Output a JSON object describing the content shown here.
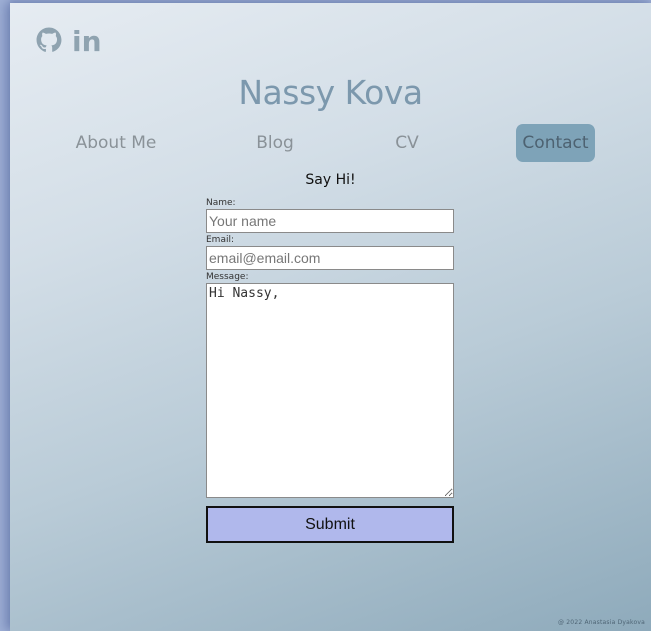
{
  "social": {
    "github_icon": "github-icon",
    "linkedin_icon": "linkedin-icon",
    "linkedin_text": "in"
  },
  "header": {
    "brand": "Nassy Kova"
  },
  "nav": {
    "items": [
      {
        "label": "About Me",
        "active": false
      },
      {
        "label": "Blog",
        "active": false
      },
      {
        "label": "CV",
        "active": false
      },
      {
        "label": "Contact",
        "active": true
      }
    ]
  },
  "contact": {
    "heading": "Say Hi!",
    "name_label": "Name:",
    "name_placeholder": "Your name",
    "email_label": "Email:",
    "email_placeholder": "email@email.com",
    "message_label": "Message:",
    "message_value": "Hi Nassy,",
    "submit_label": "Submit"
  },
  "footer": {
    "copyright": "@ 2022 Anastasia Dyakova"
  },
  "colors": {
    "accent": "#7ea3b8",
    "submit_bg": "#b0b8ec",
    "brand_text": "#7c98ad"
  }
}
